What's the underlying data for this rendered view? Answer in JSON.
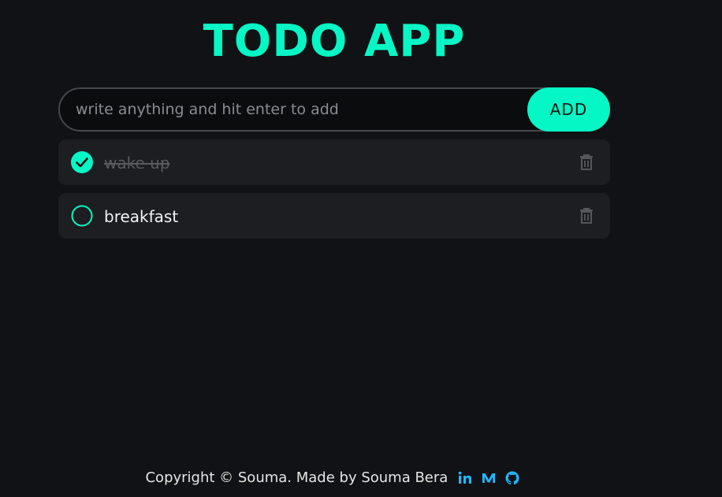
{
  "app": {
    "title": "TODO APP"
  },
  "add_form": {
    "placeholder": "write anything and hit enter to add",
    "value": "",
    "button_label": "ADD"
  },
  "todos": [
    {
      "text": "wake up",
      "completed": true,
      "icon": "check-circle-icon",
      "delete_icon": "trash-icon"
    },
    {
      "text": "breakfast",
      "completed": false,
      "icon": "empty-circle-icon",
      "delete_icon": "trash-icon"
    }
  ],
  "footer": {
    "text": "Copyright © Souma. Made by Souma Bera",
    "links": [
      {
        "icon": "linkedin-icon"
      },
      {
        "icon": "medium-icon"
      },
      {
        "icon": "github-icon"
      }
    ]
  },
  "colors": {
    "background": "#111215",
    "accent": "#04f7c4",
    "card": "#1d1e22",
    "muted": "#5a5b60"
  }
}
